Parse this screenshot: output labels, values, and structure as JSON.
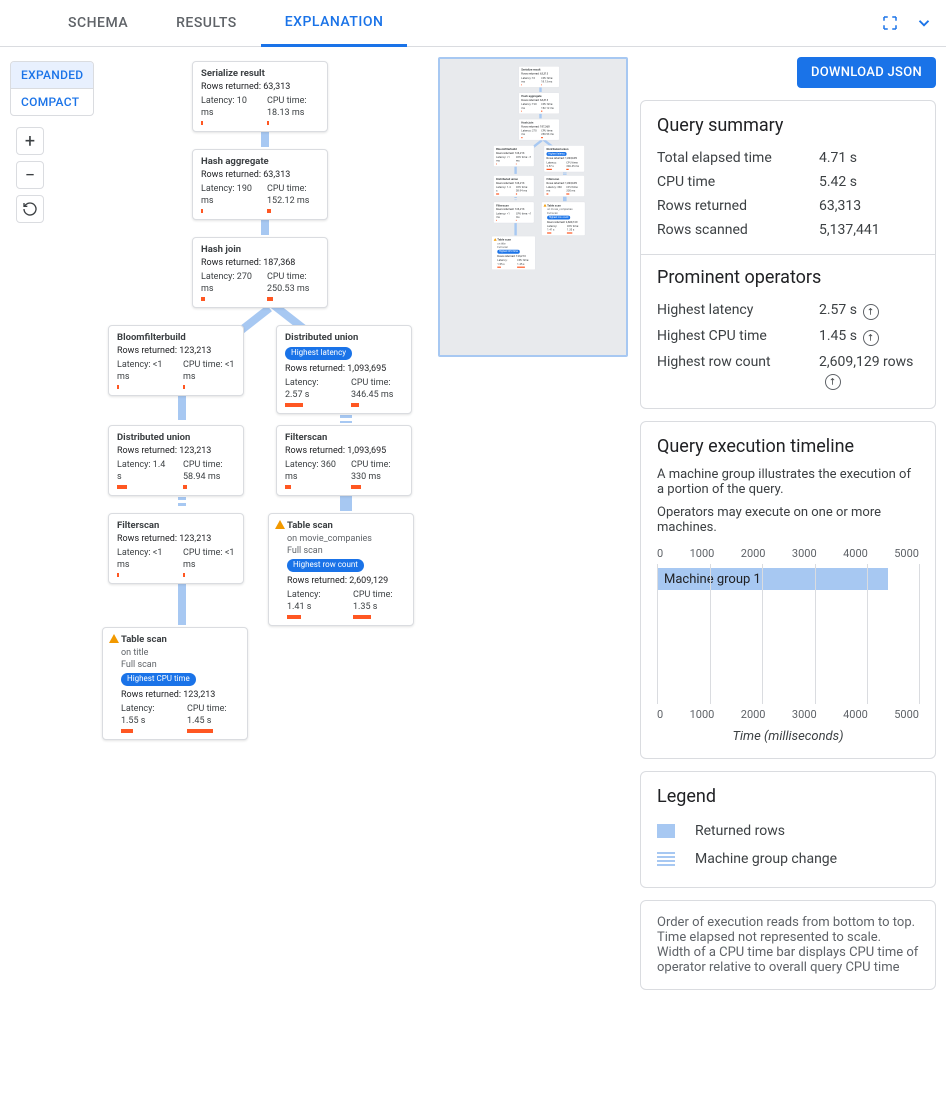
{
  "tabs": {
    "schema": "SCHEMA",
    "results": "RESULTS",
    "explanation": "EXPLANATION"
  },
  "view": {
    "expanded": "EXPANDED",
    "compact": "COMPACT"
  },
  "download": "DOWNLOAD JSON",
  "nodes": {
    "serialize": {
      "title": "Serialize result",
      "rows": "Rows returned: 63,313",
      "lat_label": "Latency: 10 ms",
      "cpu_label": "CPU time: 18.13 ms",
      "lat_bar": 2,
      "cpu_bar": 2
    },
    "hashagg": {
      "title": "Hash aggregate",
      "rows": "Rows returned: 63,313",
      "lat_label": "Latency: 190 ms",
      "cpu_label": "CPU time: 152.12 ms",
      "lat_bar": 2,
      "cpu_bar": 4
    },
    "hashjoin": {
      "title": "Hash join",
      "rows": "Rows returned: 187,368",
      "lat_label": "Latency: 270 ms",
      "cpu_label": "CPU time: 250.53 ms",
      "lat_bar": 4,
      "cpu_bar": 6
    },
    "bloom": {
      "title": "Bloomfilterbuild",
      "rows": "Rows returned: 123,213",
      "lat_label": "Latency: <1 ms",
      "cpu_label": "CPU time: <1 ms",
      "lat_bar": 2,
      "cpu_bar": 2
    },
    "dunion_r": {
      "title": "Distributed union",
      "rows": "Rows returned: 1,093,695",
      "lat_label": "Latency: 2.57 s",
      "cpu_label": "CPU time: 346.45 ms",
      "lat_bar": 18,
      "cpu_bar": 8,
      "badge": "Highest latency"
    },
    "dunion_l": {
      "title": "Distributed union",
      "rows": "Rows returned: 123,213",
      "lat_label": "Latency: 1.4 s",
      "cpu_label": "CPU time: 58.94 ms",
      "lat_bar": 10,
      "cpu_bar": 4
    },
    "filter_l": {
      "title": "Filterscan",
      "rows": "Rows returned: 123,213",
      "lat_label": "Latency: <1 ms",
      "cpu_label": "CPU time: <1 ms",
      "lat_bar": 2,
      "cpu_bar": 2
    },
    "filter_r": {
      "title": "Filterscan",
      "rows": "Rows returned: 1,093,695",
      "lat_label": "Latency: 360 ms",
      "cpu_label": "CPU time: 330 ms",
      "lat_bar": 6,
      "cpu_bar": 10
    },
    "scan_r": {
      "title": "Table scan",
      "on": "on movie_companies",
      "full": "Full scan",
      "badge": "Highest row count",
      "rows": "Rows returned: 2,609,129",
      "lat_label": "Latency: 1.41 s",
      "cpu_label": "CPU time: 1.35 s",
      "lat_bar": 14,
      "cpu_bar": 18
    },
    "scan_l": {
      "title": "Table scan",
      "on": "on title",
      "full": "Full scan",
      "badge": "Highest CPU time",
      "rows": "Rows returned: 123,213",
      "lat_label": "Latency: 1.55 s",
      "cpu_label": "CPU time: 1.45 s",
      "lat_bar": 12,
      "cpu_bar": 26
    }
  },
  "summary": {
    "heading": "Query summary",
    "rows": {
      "elapsed": {
        "k": "Total elapsed time",
        "v": "4.71 s"
      },
      "cpu": {
        "k": "CPU time",
        "v": "5.42 s"
      },
      "ret": {
        "k": "Rows returned",
        "v": "63,313"
      },
      "scan": {
        "k": "Rows scanned",
        "v": "5,137,441"
      }
    }
  },
  "prominent": {
    "heading": "Prominent operators",
    "rows": {
      "lat": {
        "k": "Highest latency",
        "v": "2.57 s"
      },
      "cpu": {
        "k": "Highest CPU time",
        "v": "1.45 s"
      },
      "rows": {
        "k": "Highest row count",
        "v": "2,609,129 rows"
      }
    }
  },
  "timeline": {
    "heading": "Query execution timeline",
    "desc1": "A machine group illustrates the execution of a portion of the query.",
    "desc2": "Operators may execute on one or more machines.",
    "ticks": [
      "0",
      "1000",
      "2000",
      "3000",
      "4000",
      "5000"
    ],
    "bar_label": "Machine group 1",
    "bar_pct": 88,
    "caption": "Time (milliseconds)"
  },
  "legend": {
    "heading": "Legend",
    "returned": "Returned rows",
    "mgc": "Machine group change"
  },
  "notes": {
    "l1": "Order of execution reads from bottom to top.",
    "l2": "Time elapsed not represented to scale.",
    "l3": "Width of a CPU time bar displays CPU time of operator relative to overall query CPU time"
  }
}
